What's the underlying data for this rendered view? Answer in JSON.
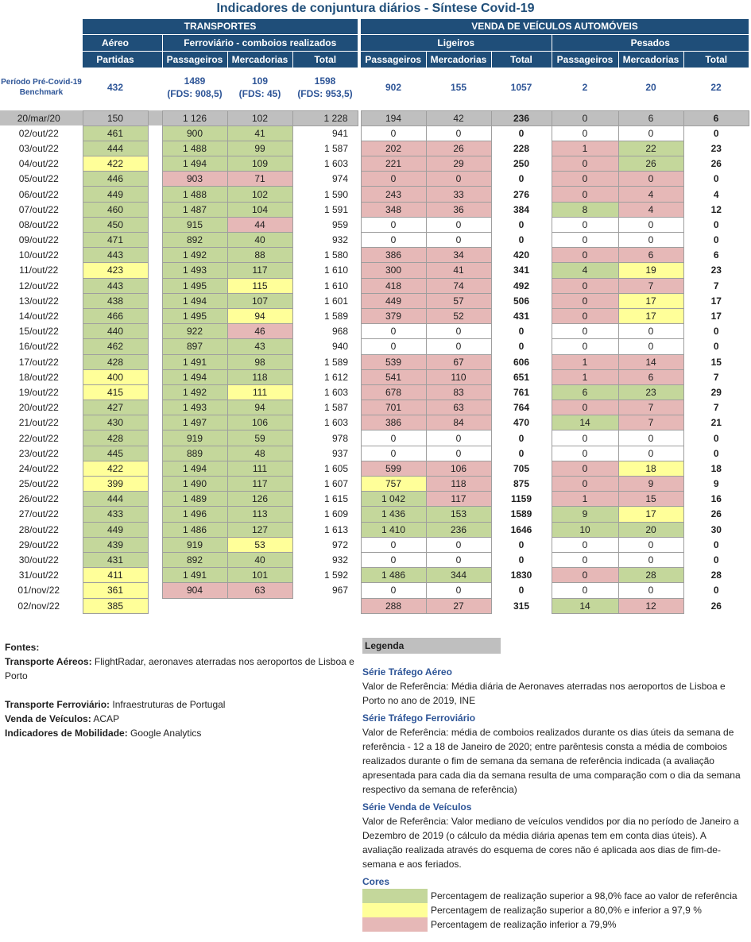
{
  "title": "Indicadores de conjuntura diários - Síntese Covid-19",
  "header": {
    "transportes": "TRANSPORTES",
    "venda": "VENDA DE VEÍCULOS AUTOMÓVEIS",
    "aereo": "Aéreo",
    "ferroviario": "Ferroviário - comboios realizados",
    "ligeiros": "Ligeiros",
    "pesados": "Pesados",
    "partidas": "Partidas",
    "passageiros": "Passageiros",
    "mercadorias": "Mercadorias",
    "total": "Total"
  },
  "benchmark": {
    "label": "Período Pré-Covid-19 Benchmark",
    "aereo": "432",
    "fer_pass": "1489",
    "fer_pass_fds": "(FDS: 908,5)",
    "fer_merc": "109",
    "fer_merc_fds": "(FDS: 45)",
    "fer_total": "1598",
    "fer_total_fds": "(FDS: 953,5)",
    "lig_pass": "902",
    "lig_merc": "155",
    "lig_total": "1057",
    "pes_pass": "2",
    "pes_merc": "20",
    "pes_total": "22"
  },
  "colors": {
    "green": "#c4d79b",
    "yellow": "#ffff99",
    "pink": "#e6b8b7",
    "gray": "#bfbfbf",
    "header_blue": "#1f4e79"
  },
  "rows": [
    {
      "date": "20/mar/20",
      "v": [
        "150",
        "1 126",
        "102",
        "1 228",
        "194",
        "42",
        "236",
        "0",
        "6",
        "6"
      ],
      "c": [
        "",
        "",
        "",
        "",
        "",
        "",
        "",
        "",
        "",
        ""
      ],
      "gray": true
    },
    {
      "date": "02/out/22",
      "v": [
        "461",
        "900",
        "41",
        "941",
        "0",
        "0",
        "0",
        "0",
        "0",
        "0"
      ],
      "c": [
        "g",
        "g",
        "g",
        "",
        "w",
        "w",
        "w",
        "w",
        "w",
        "w"
      ]
    },
    {
      "date": "03/out/22",
      "v": [
        "444",
        "1 488",
        "99",
        "1 587",
        "202",
        "26",
        "228",
        "1",
        "22",
        "23"
      ],
      "c": [
        "g",
        "g",
        "g",
        "",
        "p",
        "p",
        "p",
        "p",
        "g",
        "g"
      ]
    },
    {
      "date": "04/out/22",
      "v": [
        "422",
        "1 494",
        "109",
        "1 603",
        "221",
        "29",
        "250",
        "0",
        "26",
        "26"
      ],
      "c": [
        "y",
        "g",
        "g",
        "",
        "p",
        "p",
        "p",
        "p",
        "g",
        "g"
      ]
    },
    {
      "date": "05/out/22",
      "v": [
        "446",
        "903",
        "71",
        "974",
        "0",
        "0",
        "0",
        "0",
        "0",
        "0"
      ],
      "c": [
        "g",
        "p",
        "p",
        "",
        "p",
        "p",
        "p",
        "p",
        "p",
        "p"
      ]
    },
    {
      "date": "06/out/22",
      "v": [
        "449",
        "1 488",
        "102",
        "1 590",
        "243",
        "33",
        "276",
        "0",
        "4",
        "4"
      ],
      "c": [
        "g",
        "g",
        "g",
        "",
        "p",
        "p",
        "p",
        "p",
        "p",
        "p"
      ]
    },
    {
      "date": "07/out/22",
      "v": [
        "460",
        "1 487",
        "104",
        "1 591",
        "348",
        "36",
        "384",
        "8",
        "4",
        "12"
      ],
      "c": [
        "g",
        "g",
        "g",
        "",
        "p",
        "p",
        "p",
        "g",
        "p",
        "p"
      ]
    },
    {
      "date": "08/out/22",
      "v": [
        "450",
        "915",
        "44",
        "959",
        "0",
        "0",
        "0",
        "0",
        "0",
        "0"
      ],
      "c": [
        "g",
        "g",
        "p",
        "",
        "w",
        "w",
        "w",
        "w",
        "w",
        "w"
      ]
    },
    {
      "date": "09/out/22",
      "v": [
        "471",
        "892",
        "40",
        "932",
        "0",
        "0",
        "0",
        "0",
        "0",
        "0"
      ],
      "c": [
        "g",
        "g",
        "g",
        "",
        "w",
        "w",
        "w",
        "w",
        "w",
        "w"
      ]
    },
    {
      "date": "10/out/22",
      "v": [
        "443",
        "1 492",
        "88",
        "1 580",
        "386",
        "34",
        "420",
        "0",
        "6",
        "6"
      ],
      "c": [
        "g",
        "g",
        "g",
        "",
        "p",
        "p",
        "p",
        "p",
        "p",
        "p"
      ]
    },
    {
      "date": "11/out/22",
      "v": [
        "423",
        "1 493",
        "117",
        "1 610",
        "300",
        "41",
        "341",
        "4",
        "19",
        "23"
      ],
      "c": [
        "y",
        "g",
        "g",
        "",
        "p",
        "p",
        "p",
        "g",
        "y",
        "y"
      ]
    },
    {
      "date": "12/out/22",
      "v": [
        "443",
        "1 495",
        "115",
        "1 610",
        "418",
        "74",
        "492",
        "0",
        "7",
        "7"
      ],
      "c": [
        "g",
        "g",
        "y",
        "",
        "p",
        "p",
        "p",
        "p",
        "p",
        "p"
      ]
    },
    {
      "date": "13/out/22",
      "v": [
        "438",
        "1 494",
        "107",
        "1 601",
        "449",
        "57",
        "506",
        "0",
        "17",
        "17"
      ],
      "c": [
        "g",
        "g",
        "g",
        "",
        "p",
        "p",
        "p",
        "p",
        "y",
        "y"
      ]
    },
    {
      "date": "14/out/22",
      "v": [
        "466",
        "1 495",
        "94",
        "1 589",
        "379",
        "52",
        "431",
        "0",
        "17",
        "17"
      ],
      "c": [
        "g",
        "g",
        "y",
        "",
        "p",
        "p",
        "p",
        "p",
        "y",
        "y"
      ]
    },
    {
      "date": "15/out/22",
      "v": [
        "440",
        "922",
        "46",
        "968",
        "0",
        "0",
        "0",
        "0",
        "0",
        "0"
      ],
      "c": [
        "g",
        "g",
        "p",
        "",
        "w",
        "w",
        "w",
        "w",
        "w",
        "w"
      ]
    },
    {
      "date": "16/out/22",
      "v": [
        "462",
        "897",
        "43",
        "940",
        "0",
        "0",
        "0",
        "0",
        "0",
        "0"
      ],
      "c": [
        "g",
        "g",
        "g",
        "",
        "w",
        "w",
        "w",
        "w",
        "w",
        "w"
      ]
    },
    {
      "date": "17/out/22",
      "v": [
        "428",
        "1 491",
        "98",
        "1 589",
        "539",
        "67",
        "606",
        "1",
        "14",
        "15"
      ],
      "c": [
        "g",
        "g",
        "g",
        "",
        "p",
        "p",
        "p",
        "p",
        "p",
        "p"
      ]
    },
    {
      "date": "18/out/22",
      "v": [
        "400",
        "1 494",
        "118",
        "1 612",
        "541",
        "110",
        "651",
        "1",
        "6",
        "7"
      ],
      "c": [
        "y",
        "g",
        "g",
        "",
        "p",
        "p",
        "p",
        "p",
        "p",
        "p"
      ]
    },
    {
      "date": "19/out/22",
      "v": [
        "415",
        "1 492",
        "111",
        "1 603",
        "678",
        "83",
        "761",
        "6",
        "23",
        "29"
      ],
      "c": [
        "y",
        "g",
        "y",
        "",
        "p",
        "p",
        "p",
        "g",
        "g",
        "g"
      ]
    },
    {
      "date": "20/out/22",
      "v": [
        "427",
        "1 493",
        "94",
        "1 587",
        "701",
        "63",
        "764",
        "0",
        "7",
        "7"
      ],
      "c": [
        "g",
        "g",
        "g",
        "",
        "p",
        "p",
        "p",
        "p",
        "p",
        "p"
      ]
    },
    {
      "date": "21/out/22",
      "v": [
        "430",
        "1 497",
        "106",
        "1 603",
        "386",
        "84",
        "470",
        "14",
        "7",
        "21"
      ],
      "c": [
        "g",
        "g",
        "g",
        "",
        "p",
        "p",
        "p",
        "g",
        "p",
        "p"
      ]
    },
    {
      "date": "22/out/22",
      "v": [
        "428",
        "919",
        "59",
        "978",
        "0",
        "0",
        "0",
        "0",
        "0",
        "0"
      ],
      "c": [
        "g",
        "g",
        "g",
        "",
        "w",
        "w",
        "w",
        "w",
        "w",
        "w"
      ]
    },
    {
      "date": "23/out/22",
      "v": [
        "445",
        "889",
        "48",
        "937",
        "0",
        "0",
        "0",
        "0",
        "0",
        "0"
      ],
      "c": [
        "g",
        "g",
        "g",
        "",
        "w",
        "w",
        "w",
        "w",
        "w",
        "w"
      ]
    },
    {
      "date": "24/out/22",
      "v": [
        "422",
        "1 494",
        "111",
        "1 605",
        "599",
        "106",
        "705",
        "0",
        "18",
        "18"
      ],
      "c": [
        "y",
        "g",
        "g",
        "",
        "p",
        "p",
        "p",
        "p",
        "y",
        "y"
      ]
    },
    {
      "date": "25/out/22",
      "v": [
        "399",
        "1 490",
        "117",
        "1 607",
        "757",
        "118",
        "875",
        "0",
        "9",
        "9"
      ],
      "c": [
        "y",
        "g",
        "g",
        "",
        "y",
        "p",
        "p",
        "p",
        "p",
        "p"
      ]
    },
    {
      "date": "26/out/22",
      "v": [
        "444",
        "1 489",
        "126",
        "1 615",
        "1 042",
        "117",
        "1159",
        "1",
        "15",
        "16"
      ],
      "c": [
        "g",
        "g",
        "g",
        "",
        "g",
        "p",
        "p",
        "p",
        "p",
        "p"
      ]
    },
    {
      "date": "27/out/22",
      "v": [
        "433",
        "1 496",
        "113",
        "1 609",
        "1 436",
        "153",
        "1589",
        "9",
        "17",
        "26"
      ],
      "c": [
        "g",
        "g",
        "g",
        "",
        "g",
        "g",
        "g",
        "g",
        "y",
        "y"
      ]
    },
    {
      "date": "28/out/22",
      "v": [
        "449",
        "1 486",
        "127",
        "1 613",
        "1 410",
        "236",
        "1646",
        "10",
        "20",
        "30"
      ],
      "c": [
        "g",
        "g",
        "g",
        "",
        "g",
        "g",
        "g",
        "g",
        "g",
        "g"
      ]
    },
    {
      "date": "29/out/22",
      "v": [
        "439",
        "919",
        "53",
        "972",
        "0",
        "0",
        "0",
        "0",
        "0",
        "0"
      ],
      "c": [
        "g",
        "g",
        "y",
        "",
        "w",
        "w",
        "w",
        "w",
        "w",
        "w"
      ]
    },
    {
      "date": "30/out/22",
      "v": [
        "431",
        "892",
        "40",
        "932",
        "0",
        "0",
        "0",
        "0",
        "0",
        "0"
      ],
      "c": [
        "g",
        "g",
        "g",
        "",
        "w",
        "w",
        "w",
        "w",
        "w",
        "w"
      ]
    },
    {
      "date": "31/out/22",
      "v": [
        "411",
        "1 491",
        "101",
        "1 592",
        "1 486",
        "344",
        "1830",
        "0",
        "28",
        "28"
      ],
      "c": [
        "y",
        "g",
        "g",
        "",
        "g",
        "g",
        "g",
        "p",
        "g",
        "g"
      ]
    },
    {
      "date": "01/nov/22",
      "v": [
        "361",
        "904",
        "63",
        "967",
        "0",
        "0",
        "0",
        "0",
        "0",
        "0"
      ],
      "c": [
        "y",
        "p",
        "p",
        "",
        "w",
        "w",
        "w",
        "w",
        "w",
        "w"
      ]
    },
    {
      "date": "02/nov/22",
      "v": [
        "385",
        "",
        "",
        "",
        "288",
        "27",
        "315",
        "14",
        "12",
        "26"
      ],
      "c": [
        "y",
        "",
        "",
        "",
        "p",
        "p",
        "p",
        "g",
        "p",
        "p"
      ]
    }
  ],
  "fontes": {
    "title": "Fontes:",
    "aereo_label": "Transporte Aéreos:",
    "aereo_text": " FlightRadar, aeronaves aterradas nos aeroportos de Lisboa e Porto",
    "fer_label": "Transporte Ferroviário:",
    "fer_text": " Infraestruturas de Portugal",
    "venda_label": "Venda de Veículos:",
    "venda_text": " ACAP",
    "mob_label": "Indicadores de Mobilidade:",
    "mob_text": " Google Analytics"
  },
  "legenda": {
    "title": "Legenda",
    "aereo_title": "Série Tráfego Aéreo",
    "aereo_text": "Valor de Referência: Média diária de Aeronaves aterradas nos aeroportos de Lisboa e Porto no ano de 2019, INE",
    "fer_title": "Série Tráfego Ferroviário",
    "fer_text": "Valor de Referência: média de comboios realizados durante os dias úteis da semana de referência - 12 a 18 de Janeiro de 2020; entre parêntesis consta a média de comboios realizados durante o fim de semana da semana de referência indicada (a avaliação apresentada para cada dia da semana resulta de uma comparação com o dia da semana respectivo da semana de referência)",
    "venda_title": "Série Venda de Veículos",
    "venda_text": "Valor de Referência: Valor mediano de veículos vendidos por dia no período de Janeiro a Dezembro de 2019 (o cálculo da média diária apenas tem em conta dias úteis). A avaliação realizada através do esquema de cores não é aplicada aos dias de fim-de-semana e aos feriados.",
    "cores_title": "Cores",
    "cor_green": "Percentagem de realização superior a 98,0% face ao valor de referência",
    "cor_yellow": "Percentagem de realização superior a 80,0% e inferior a 97,9 %",
    "cor_pink": "Percentagem de realização inferior a 79,9%"
  }
}
